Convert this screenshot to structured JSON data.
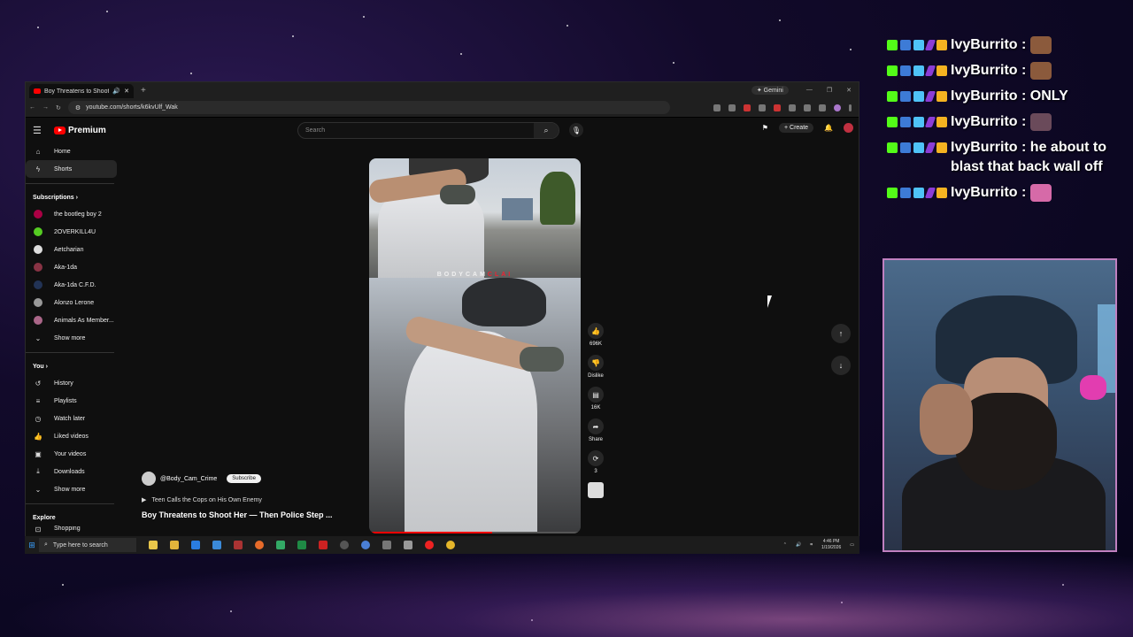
{
  "browser": {
    "tab_title": "Boy Threatens to Shoot Her ...",
    "new_tab": "+",
    "gemini_label": "Gemini",
    "url": "youtube.com/shorts/k6kvUlf_Wak"
  },
  "header": {
    "logo_label": "Premium",
    "search_placeholder": "Search",
    "create_label": "Create"
  },
  "sidebar": {
    "main": [
      {
        "label": "Home",
        "icon": "home-icon"
      },
      {
        "label": "Shorts",
        "icon": "shorts-icon"
      }
    ],
    "subscriptions_header": "Subscriptions",
    "subscriptions": [
      "the bootleg boy 2",
      "2OVERKILL4U",
      "Aetcharian",
      "Aka-1da",
      "Aka-1da C.F.D.",
      "Alonzo Lerone",
      "Animals As Member..."
    ],
    "show_more": "Show more",
    "you_header": "You",
    "you_items": [
      {
        "label": "History",
        "icon": "history-icon"
      },
      {
        "label": "Playlists",
        "icon": "playlists-icon"
      },
      {
        "label": "Watch later",
        "icon": "watch-later-icon"
      },
      {
        "label": "Liked videos",
        "icon": "thumbs-up-icon"
      },
      {
        "label": "Your videos",
        "icon": "video-icon"
      },
      {
        "label": "Downloads",
        "icon": "download-icon"
      }
    ],
    "show_more_2": "Show more",
    "explore_header": "Explore",
    "explore_item": "Shopping"
  },
  "video": {
    "watermark_a": "BODYCAM",
    "watermark_b": "CLAI",
    "progress": 0.58
  },
  "actions": {
    "likes": "696K",
    "dislike": "Dislike",
    "comments": "16K",
    "share": "Share",
    "remix": "3"
  },
  "meta": {
    "channel": "@Body_Cam_Crime",
    "subscribe": "Subscribe",
    "playlist": "Teen Calls the Cops on His Own Enemy",
    "title": "Boy Threatens to Shoot Her — Then Police Step ..."
  },
  "taskbar": {
    "search_placeholder": "Type here to search",
    "time": "4:46 PM",
    "date": "1/19/2026"
  },
  "chat": {
    "messages": [
      {
        "user": "IvyBurrito",
        "text": ""
      },
      {
        "user": "IvyBurrito",
        "text": ""
      },
      {
        "user": "IvyBurrito",
        "text": "ONLY"
      },
      {
        "user": "IvyBurrito",
        "text": ""
      },
      {
        "user": "IvyBurrito",
        "text": "he about to blast that back wall off"
      },
      {
        "user": "IvyBurrito",
        "text": ""
      }
    ]
  },
  "colors": {
    "accent": "#ff0000",
    "kick_green": "#53fc18",
    "crown": "#f5b321"
  }
}
